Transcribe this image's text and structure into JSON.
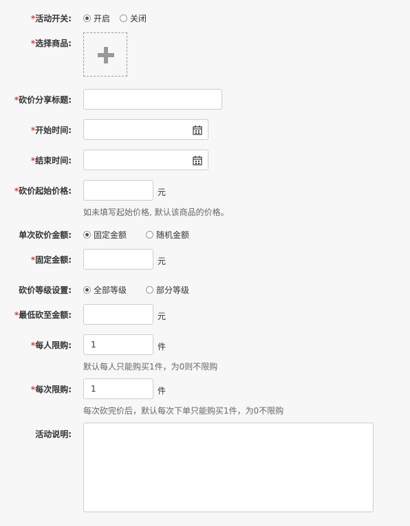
{
  "required_mark": "*",
  "activity_switch": {
    "label": "活动开关:",
    "options": [
      {
        "label": "开启",
        "checked": true
      },
      {
        "label": "关闭",
        "checked": false
      }
    ]
  },
  "select_product": {
    "label": "选择商品:",
    "icon": "plus-icon"
  },
  "share_title": {
    "label": "砍价分享标题:",
    "value": ""
  },
  "start_time": {
    "label": "开始时间:",
    "value": "",
    "icon": "calendar-icon"
  },
  "end_time": {
    "label": "结束时间:",
    "value": "",
    "icon": "calendar-icon"
  },
  "start_price": {
    "label": "砍价起始价格:",
    "value": "",
    "unit": "元",
    "help": "如未填写起始价格, 默认该商品的价格。"
  },
  "cut_amount_type": {
    "label": "单次砍价金额:",
    "options": [
      {
        "label": "固定金额",
        "checked": true
      },
      {
        "label": "随机金额",
        "checked": false
      }
    ]
  },
  "fixed_amount": {
    "label": "固定金额:",
    "value": "",
    "unit": "元"
  },
  "level_setting": {
    "label": "砍价等级设置:",
    "options": [
      {
        "label": "全部等级",
        "checked": true
      },
      {
        "label": "部分等级",
        "checked": false
      }
    ]
  },
  "min_price": {
    "label": "最低砍至金额:",
    "value": "",
    "unit": "元"
  },
  "per_person_limit": {
    "label": "每人限购:",
    "value": "1",
    "unit": "件",
    "help": "默认每人只能购买1件，为0则不限购"
  },
  "per_order_limit": {
    "label": "每次限购:",
    "value": "1",
    "unit": "件",
    "help": "每次砍完价后，默认每次下单只能购买1件，为0不限购"
  },
  "description": {
    "label": "活动说明:",
    "value": ""
  }
}
